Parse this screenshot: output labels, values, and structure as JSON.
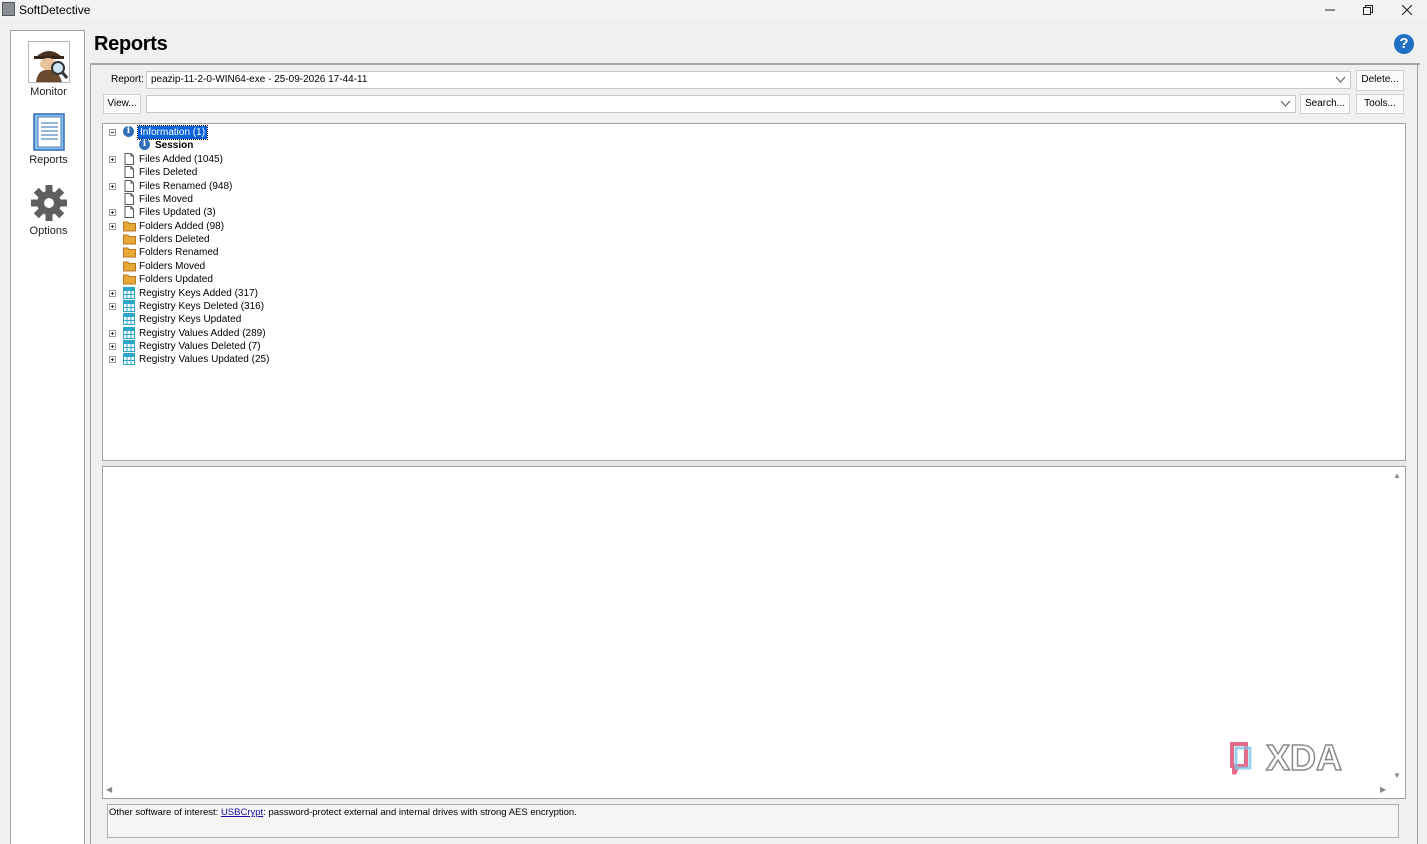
{
  "window": {
    "title": "SoftDetective",
    "controls": [
      "minimize-icon",
      "restore-icon",
      "close-icon"
    ]
  },
  "sidebar": {
    "items": [
      {
        "label": "Monitor",
        "icon": "detective-icon"
      },
      {
        "label": "Reports",
        "icon": "notebook-icon"
      },
      {
        "label": "Options",
        "icon": "gear-icon"
      }
    ]
  },
  "header": {
    "title": "Reports",
    "help_icon": "?"
  },
  "report_bar": {
    "label": "Report:",
    "selected": "peazip-11-2-0-WIN64-exe - 25-09-2026 17-44-11",
    "delete_label": "Delete..."
  },
  "view_bar": {
    "view_label": "View...",
    "value": "",
    "search_label": "Search...",
    "tools_label": "Tools..."
  },
  "tree": {
    "root": {
      "label": "Information (1)",
      "expanded": true,
      "selected": true,
      "icon": "info-icon"
    },
    "session": {
      "label": "Session",
      "icon": "info-icon"
    },
    "items": [
      {
        "label": "Files Added (1045)",
        "expandable": true,
        "icon": "file-icon"
      },
      {
        "label": "Files Deleted",
        "expandable": false,
        "icon": "file-icon"
      },
      {
        "label": "Files Renamed (948)",
        "expandable": true,
        "icon": "file-icon"
      },
      {
        "label": "Files Moved",
        "expandable": false,
        "icon": "file-icon"
      },
      {
        "label": "Files Updated (3)",
        "expandable": true,
        "icon": "file-icon"
      },
      {
        "label": "Folders Added (98)",
        "expandable": true,
        "icon": "folder-icon"
      },
      {
        "label": "Folders Deleted",
        "expandable": false,
        "icon": "folder-icon"
      },
      {
        "label": "Folders Renamed",
        "expandable": false,
        "icon": "folder-icon"
      },
      {
        "label": "Folders Moved",
        "expandable": false,
        "icon": "folder-icon"
      },
      {
        "label": "Folders Updated",
        "expandable": false,
        "icon": "folder-icon"
      },
      {
        "label": "Registry Keys Added (317)",
        "expandable": true,
        "icon": "registry-icon"
      },
      {
        "label": "Registry Keys Deleted (316)",
        "expandable": true,
        "icon": "registry-icon"
      },
      {
        "label": "Registry Keys Updated",
        "expandable": false,
        "icon": "registry-icon"
      },
      {
        "label": "Registry Values Added (289)",
        "expandable": true,
        "icon": "registry-icon"
      },
      {
        "label": "Registry Values Deleted (7)",
        "expandable": true,
        "icon": "registry-icon"
      },
      {
        "label": "Registry Values Updated (25)",
        "expandable": true,
        "icon": "registry-icon"
      }
    ]
  },
  "detail_pane": {
    "content": ""
  },
  "watermark": "XDA",
  "footer": {
    "prefix": "Other software of interest: ",
    "link": "USBCrypt",
    "suffix": ": password-protect external and internal drives with strong AES encryption."
  },
  "colors": {
    "selection": "#0a64d8",
    "info_icon": "#2f6db7",
    "folder": "#e8a838",
    "registry": "#2aa6c8",
    "help": "#1f6fc2"
  }
}
